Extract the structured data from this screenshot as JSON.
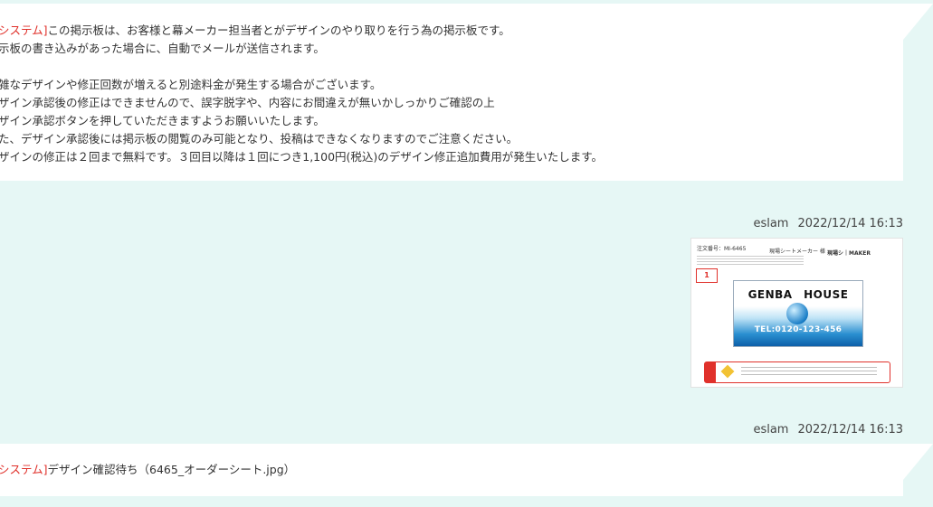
{
  "messages": [
    {
      "tag": "システム]",
      "lines": [
        "この掲示板は、お客様と幕メーカー担当者とがデザインのやり取りを行う為の掲示板です。",
        "示板の書き込みがあった場合に、自動でメールが送信されます。",
        "雑なデザインや修正回数が増えると別途料金が発生する場合がございます。",
        "ザイン承認後の修正はできませんので、誤字脱字や、内容にお間違えが無いかしっかりご確認の上",
        "ザイン承認ボタンを押していただきますようお願いいたします。",
        "た、デザイン承認後には掲示板の閲覧のみ可能となり、投稿はできなくなりますのでご注意ください。",
        "ザインの修正は２回まで無料です。３回目以降は１回につき1,100円(税込)のデザイン修正追加費用が発生いたします。"
      ]
    },
    {
      "author": "eslam",
      "timestamp": "2022/12/14 16:13",
      "attachment": {
        "order_no": "注文番号：MI-6465",
        "sheet_title": "現場シートメーカー 様",
        "brand": "現場シ｜MAKER",
        "badge": "1",
        "card_title": "GENBA　HOUSE",
        "card_tel": "TEL:0120-123-456"
      }
    },
    {
      "author": "eslam",
      "timestamp": "2022/12/14 16:13",
      "tag": "システム]",
      "text": "デザイン確認待ち（6465_オーダーシート.jpg）"
    }
  ],
  "colors": {
    "accent": "#e0312b",
    "background": "#e6f7f5",
    "bubble": "#ffffff"
  }
}
